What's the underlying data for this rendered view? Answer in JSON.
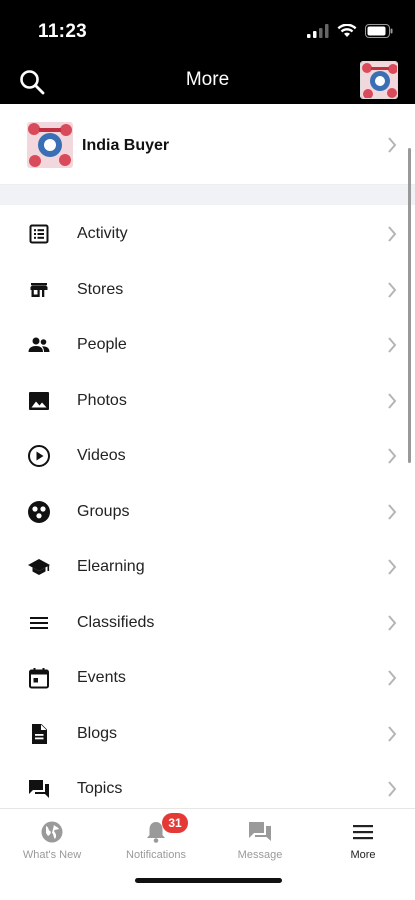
{
  "status_bar": {
    "time": "11:23"
  },
  "header": {
    "title": "More"
  },
  "profile": {
    "name": "India Buyer"
  },
  "menu": {
    "items": [
      {
        "label": "Activity",
        "icon": "activity-icon"
      },
      {
        "label": "Stores",
        "icon": "store-icon"
      },
      {
        "label": "People",
        "icon": "people-icon"
      },
      {
        "label": "Photos",
        "icon": "photo-icon"
      },
      {
        "label": "Videos",
        "icon": "video-icon"
      },
      {
        "label": "Groups",
        "icon": "groups-icon"
      },
      {
        "label": "Elearning",
        "icon": "school-icon"
      },
      {
        "label": "Classifieds",
        "icon": "menu-lines-icon"
      },
      {
        "label": "Events",
        "icon": "calendar-icon"
      },
      {
        "label": "Blogs",
        "icon": "document-icon"
      },
      {
        "label": "Topics",
        "icon": "forum-icon"
      }
    ]
  },
  "tabs": {
    "whats_new": "What's New",
    "notifications": "Notifications",
    "notifications_badge": "31",
    "message": "Message",
    "more": "More"
  },
  "colors": {
    "header_bg": "#000000",
    "badge": "#e53935",
    "inactive_tab": "#9a9a9a"
  }
}
